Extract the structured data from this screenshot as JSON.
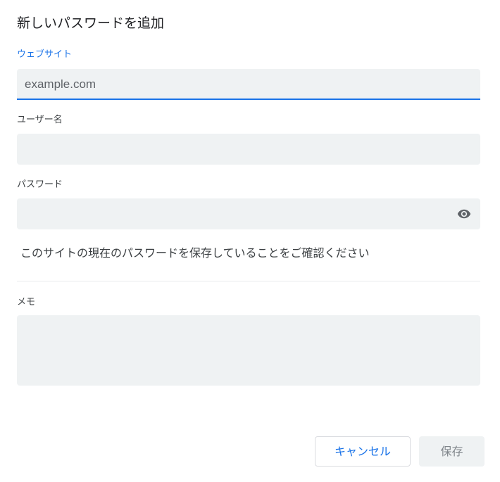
{
  "dialog": {
    "title": "新しいパスワードを追加"
  },
  "website": {
    "label": "ウェブサイト",
    "placeholder": "example.com",
    "value": ""
  },
  "username": {
    "label": "ユーザー名",
    "value": ""
  },
  "password": {
    "label": "パスワード",
    "value": "",
    "toggle_icon": "eye-icon"
  },
  "notice": {
    "text": "このサイトの現在のパスワードを保存していることをご確認ください"
  },
  "note": {
    "label": "メモ",
    "value": ""
  },
  "buttons": {
    "cancel": "キャンセル",
    "save": "保存"
  },
  "colors": {
    "accent": "#1a73e8",
    "field_bg": "#eff2f3",
    "disabled_text": "#80868b"
  }
}
